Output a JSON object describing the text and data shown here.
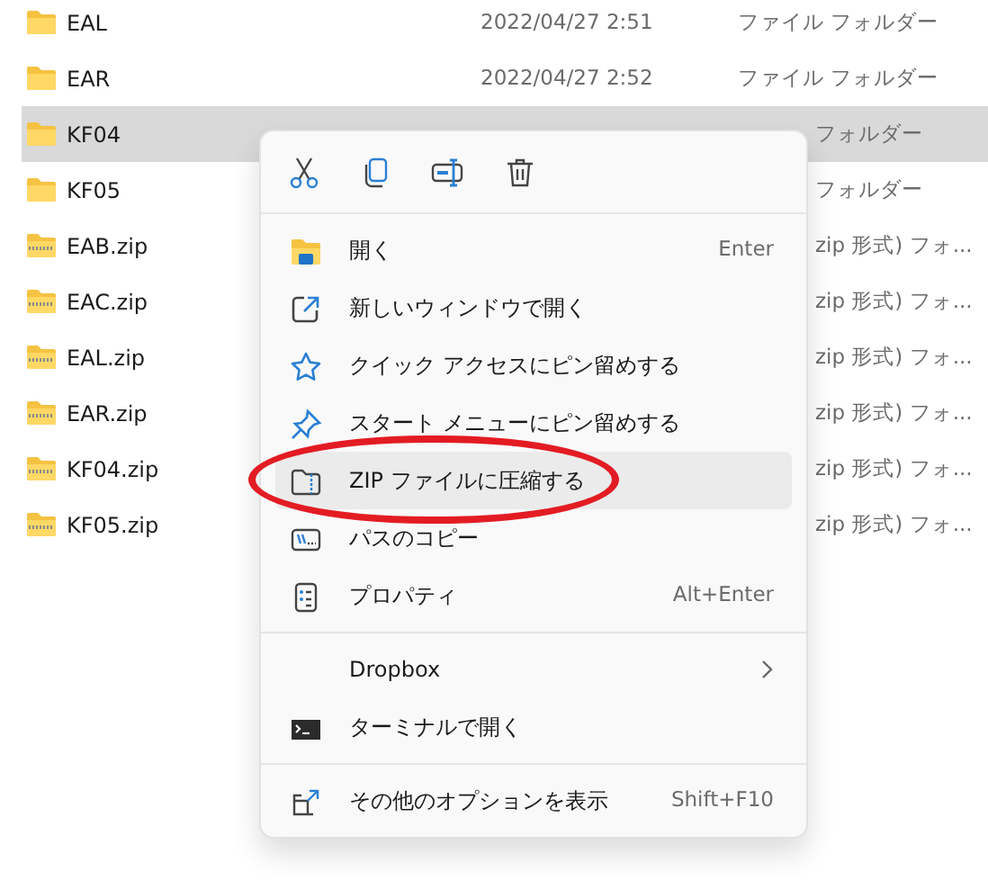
{
  "files": [
    {
      "name": "EAL",
      "date": "2022/04/27 2:51",
      "type": "ファイル フォルダー",
      "kind": "folder",
      "selected": false
    },
    {
      "name": "EAR",
      "date": "2022/04/27 2:52",
      "type": "ファイル フォルダー",
      "kind": "folder",
      "selected": false
    },
    {
      "name": "KF04",
      "type": "フォルダー",
      "kind": "folder",
      "selected": true
    },
    {
      "name": "KF05",
      "type": "フォルダー",
      "kind": "folder",
      "selected": false
    },
    {
      "name": "EAB.zip",
      "type": "zip 形式) フォ...",
      "kind": "zip",
      "selected": false
    },
    {
      "name": "EAC.zip",
      "type": "zip 形式) フォ...",
      "kind": "zip",
      "selected": false
    },
    {
      "name": "EAL.zip",
      "type": "zip 形式) フォ...",
      "kind": "zip",
      "selected": false
    },
    {
      "name": "EAR.zip",
      "type": "zip 形式) フォ...",
      "kind": "zip",
      "selected": false
    },
    {
      "name": "KF04.zip",
      "type": "zip 形式) フォ...",
      "kind": "zip",
      "selected": false
    },
    {
      "name": "KF05.zip",
      "type": "zip 形式) フォ...",
      "kind": "zip",
      "selected": false
    }
  ],
  "context_menu": {
    "groups": [
      [
        {
          "label": "開く",
          "shortcut": "Enter",
          "hovered": false,
          "circled": false
        },
        {
          "label": "新しいウィンドウで開く",
          "hovered": false,
          "circled": false
        },
        {
          "label": "クイック アクセスにピン留めする",
          "hovered": false,
          "circled": false
        },
        {
          "label": "スタート メニューにピン留めする",
          "hovered": false,
          "circled": false
        },
        {
          "label": "ZIP ファイルに圧縮する",
          "hovered": true,
          "circled": true
        },
        {
          "label": "パスのコピー",
          "hovered": false,
          "circled": false
        },
        {
          "label": "プロパティ",
          "shortcut": "Alt+Enter",
          "hovered": false,
          "circled": false
        }
      ],
      [
        {
          "label": "Dropbox",
          "submenu": true,
          "hovered": false,
          "circled": false
        },
        {
          "label": "ターミナルで開く",
          "hovered": false,
          "circled": false
        }
      ],
      [
        {
          "label": "その他のオプションを表示",
          "shortcut": "Shift+F10",
          "hovered": false,
          "circled": false
        }
      ]
    ]
  }
}
